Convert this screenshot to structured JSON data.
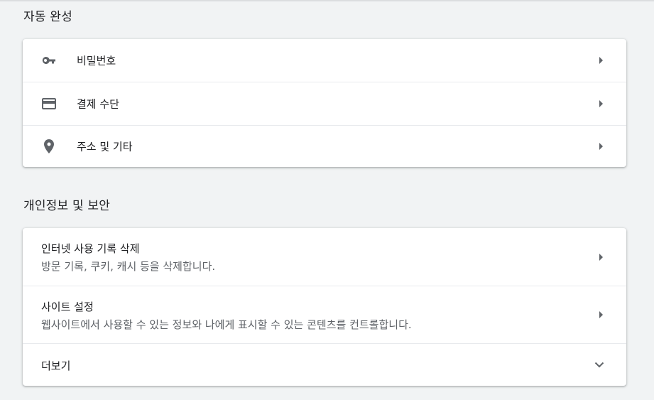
{
  "autofill": {
    "title": "자동 완성",
    "items": [
      {
        "label": "비밀번호",
        "icon": "key-icon"
      },
      {
        "label": "결제 수단",
        "icon": "credit-card-icon"
      },
      {
        "label": "주소 및 기타",
        "icon": "location-pin-icon"
      }
    ]
  },
  "privacy": {
    "title": "개인정보 및 보안",
    "items": [
      {
        "title": "인터넷 사용 기록 삭제",
        "subtitle": "방문 기록, 쿠키, 캐시 등을 삭제합니다."
      },
      {
        "title": "사이트 설정",
        "subtitle": "웹사이트에서 사용할 수 있는 정보와 나에게 표시할 수 있는 콘텐츠를 컨트롤합니다."
      },
      {
        "title": "더보기"
      }
    ]
  },
  "colors": {
    "icon": "#5f6368",
    "text": "#202124",
    "secondary_text": "#5f6368",
    "background": "#f1f3f4"
  }
}
